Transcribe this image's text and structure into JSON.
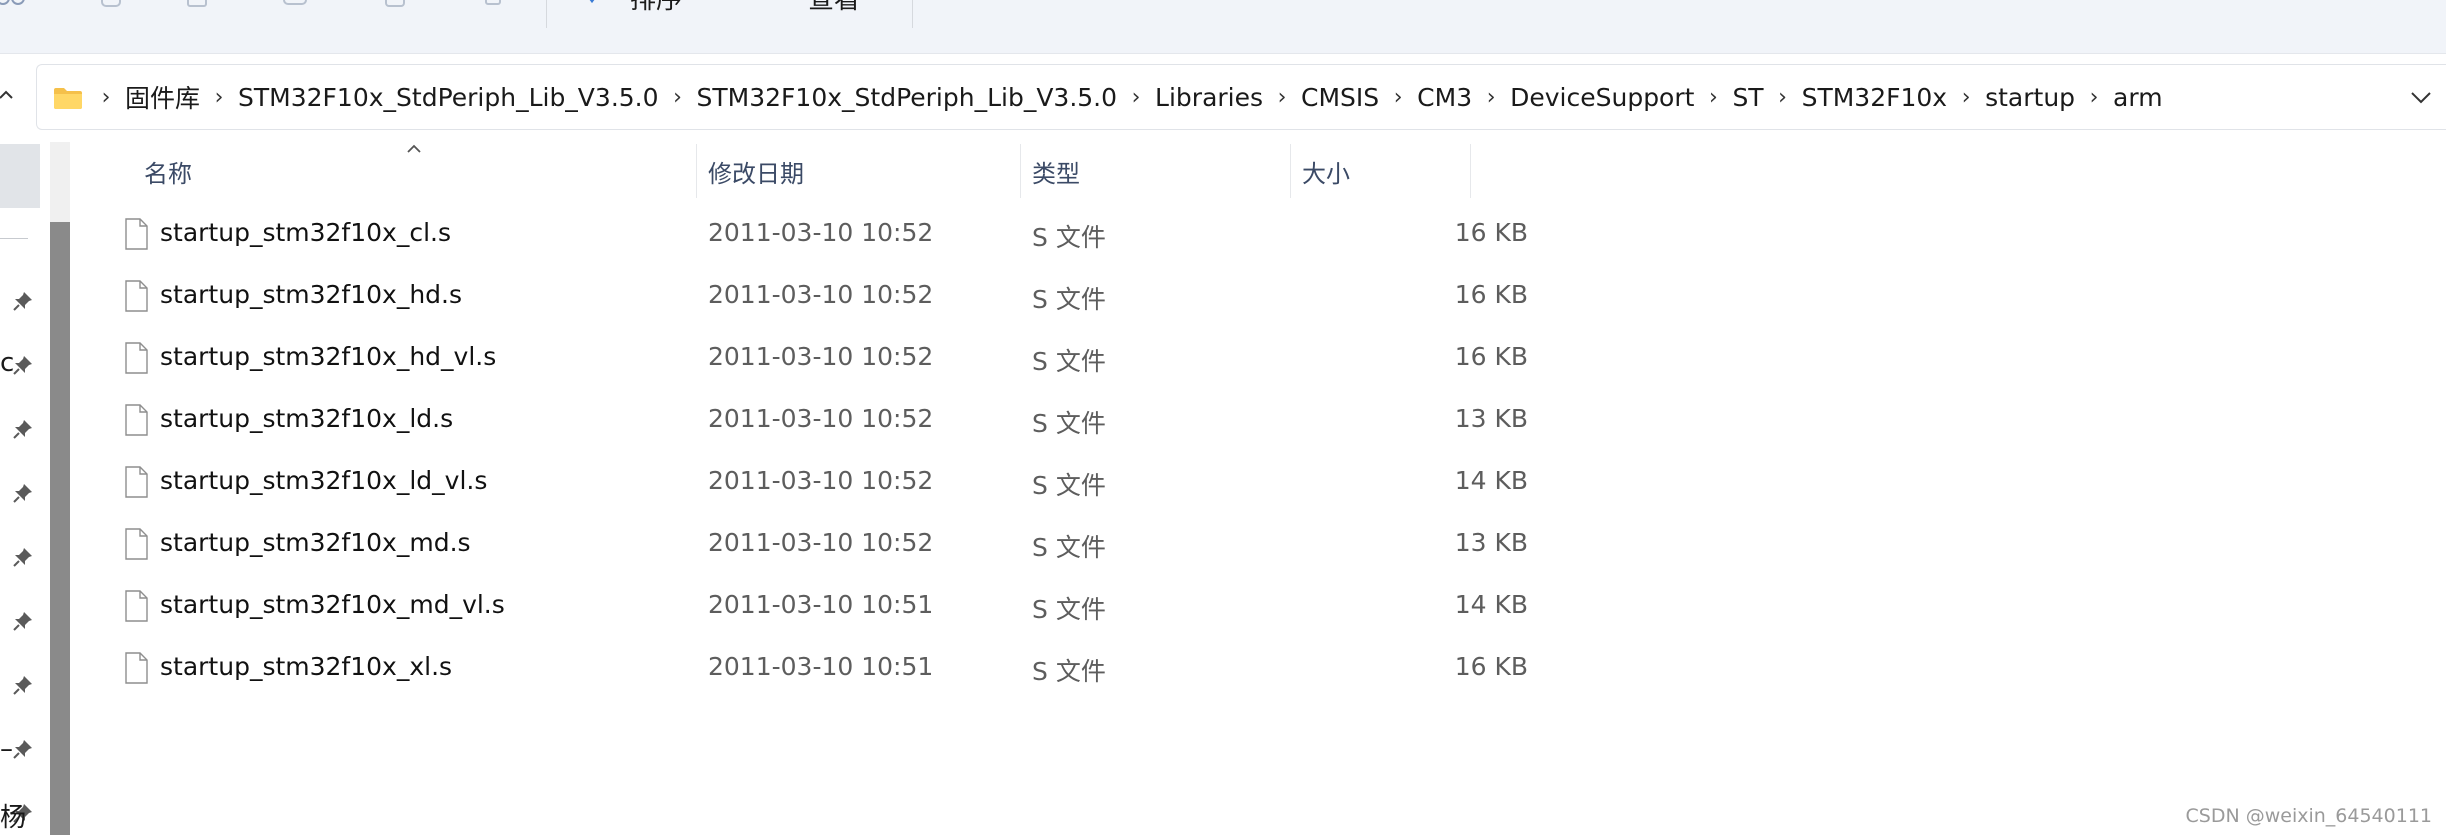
{
  "toolbar": {
    "sort_label": "排序",
    "view_label": "查看"
  },
  "address": {
    "crumbs": [
      "固件库",
      "STM32F10x_StdPeriph_Lib_V3.5.0",
      "STM32F10x_StdPeriph_Lib_V3.5.0",
      "Libraries",
      "CMSIS",
      "CM3",
      "DeviceSupport",
      "ST",
      "STM32F10x",
      "startup",
      "arm"
    ]
  },
  "nav": {
    "chars": [
      "c",
      "–",
      "杨"
    ]
  },
  "columns": {
    "name": "名称",
    "date": "修改日期",
    "type": "类型",
    "size": "大小"
  },
  "files": [
    {
      "name": "startup_stm32f10x_cl.s",
      "date": "2011-03-10 10:52",
      "type": "S 文件",
      "size": "16 KB"
    },
    {
      "name": "startup_stm32f10x_hd.s",
      "date": "2011-03-10 10:52",
      "type": "S 文件",
      "size": "16 KB"
    },
    {
      "name": "startup_stm32f10x_hd_vl.s",
      "date": "2011-03-10 10:52",
      "type": "S 文件",
      "size": "16 KB"
    },
    {
      "name": "startup_stm32f10x_ld.s",
      "date": "2011-03-10 10:52",
      "type": "S 文件",
      "size": "13 KB"
    },
    {
      "name": "startup_stm32f10x_ld_vl.s",
      "date": "2011-03-10 10:52",
      "type": "S 文件",
      "size": "14 KB"
    },
    {
      "name": "startup_stm32f10x_md.s",
      "date": "2011-03-10 10:52",
      "type": "S 文件",
      "size": "13 KB"
    },
    {
      "name": "startup_stm32f10x_md_vl.s",
      "date": "2011-03-10 10:51",
      "type": "S 文件",
      "size": "14 KB"
    },
    {
      "name": "startup_stm32f10x_xl.s",
      "date": "2011-03-10 10:51",
      "type": "S 文件",
      "size": "16 KB"
    }
  ],
  "watermark": "CSDN @weixin_64540111",
  "colors": {
    "accent": "#3b4a66",
    "toolbar_bg": "#f1f4f9",
    "folder": "#f5c04a"
  }
}
